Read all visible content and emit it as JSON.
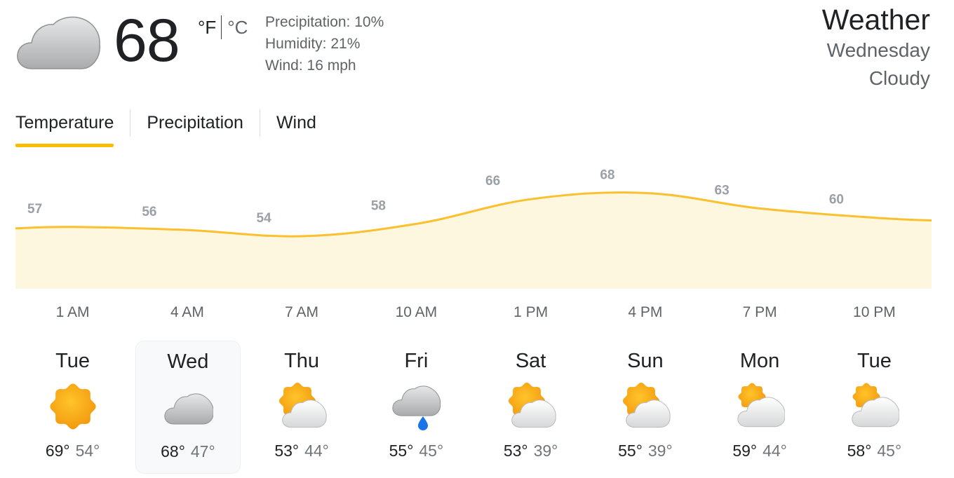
{
  "current": {
    "temperature": "68",
    "unit_f": "°F",
    "unit_c": "°C",
    "precipitation": "Precipitation: 10%",
    "humidity": "Humidity: 21%",
    "wind": "Wind: 16 mph",
    "icon": "cloud-icon"
  },
  "summary": {
    "title": "Weather",
    "day": "Wednesday",
    "condition": "Cloudy"
  },
  "tabs": [
    {
      "label": "Temperature",
      "active": true
    },
    {
      "label": "Precipitation",
      "active": false
    },
    {
      "label": "Wind",
      "active": false
    }
  ],
  "chart_data": {
    "type": "area",
    "x": [
      "1 AM",
      "4 AM",
      "7 AM",
      "10 AM",
      "1 PM",
      "4 PM",
      "7 PM",
      "10 PM"
    ],
    "values": [
      57,
      56,
      54,
      58,
      66,
      68,
      63,
      60
    ],
    "fill_color": "#fef7e0",
    "line_color": "#fbc02d",
    "grid": false
  },
  "days": [
    {
      "name": "Tue",
      "icon": "sunny-icon",
      "high": "69°",
      "low": "54°",
      "selected": false
    },
    {
      "name": "Wed",
      "icon": "cloudy-icon",
      "high": "68°",
      "low": "47°",
      "selected": true
    },
    {
      "name": "Thu",
      "icon": "partly-cloudy-icon",
      "high": "53°",
      "low": "44°",
      "selected": false
    },
    {
      "name": "Fri",
      "icon": "rain-icon",
      "high": "55°",
      "low": "45°",
      "selected": false
    },
    {
      "name": "Sat",
      "icon": "partly-cloudy-icon",
      "high": "53°",
      "low": "39°",
      "selected": false
    },
    {
      "name": "Sun",
      "icon": "partly-cloudy-icon",
      "high": "55°",
      "low": "39°",
      "selected": false
    },
    {
      "name": "Mon",
      "icon": "mostly-cloudy-icon",
      "high": "59°",
      "low": "44°",
      "selected": false
    },
    {
      "name": "Tue",
      "icon": "mostly-cloudy-icon",
      "high": "58°",
      "low": "45°",
      "selected": false
    }
  ],
  "colors": {
    "accent": "#fbbc04",
    "text_primary": "#202124",
    "text_secondary": "#5f6368"
  }
}
